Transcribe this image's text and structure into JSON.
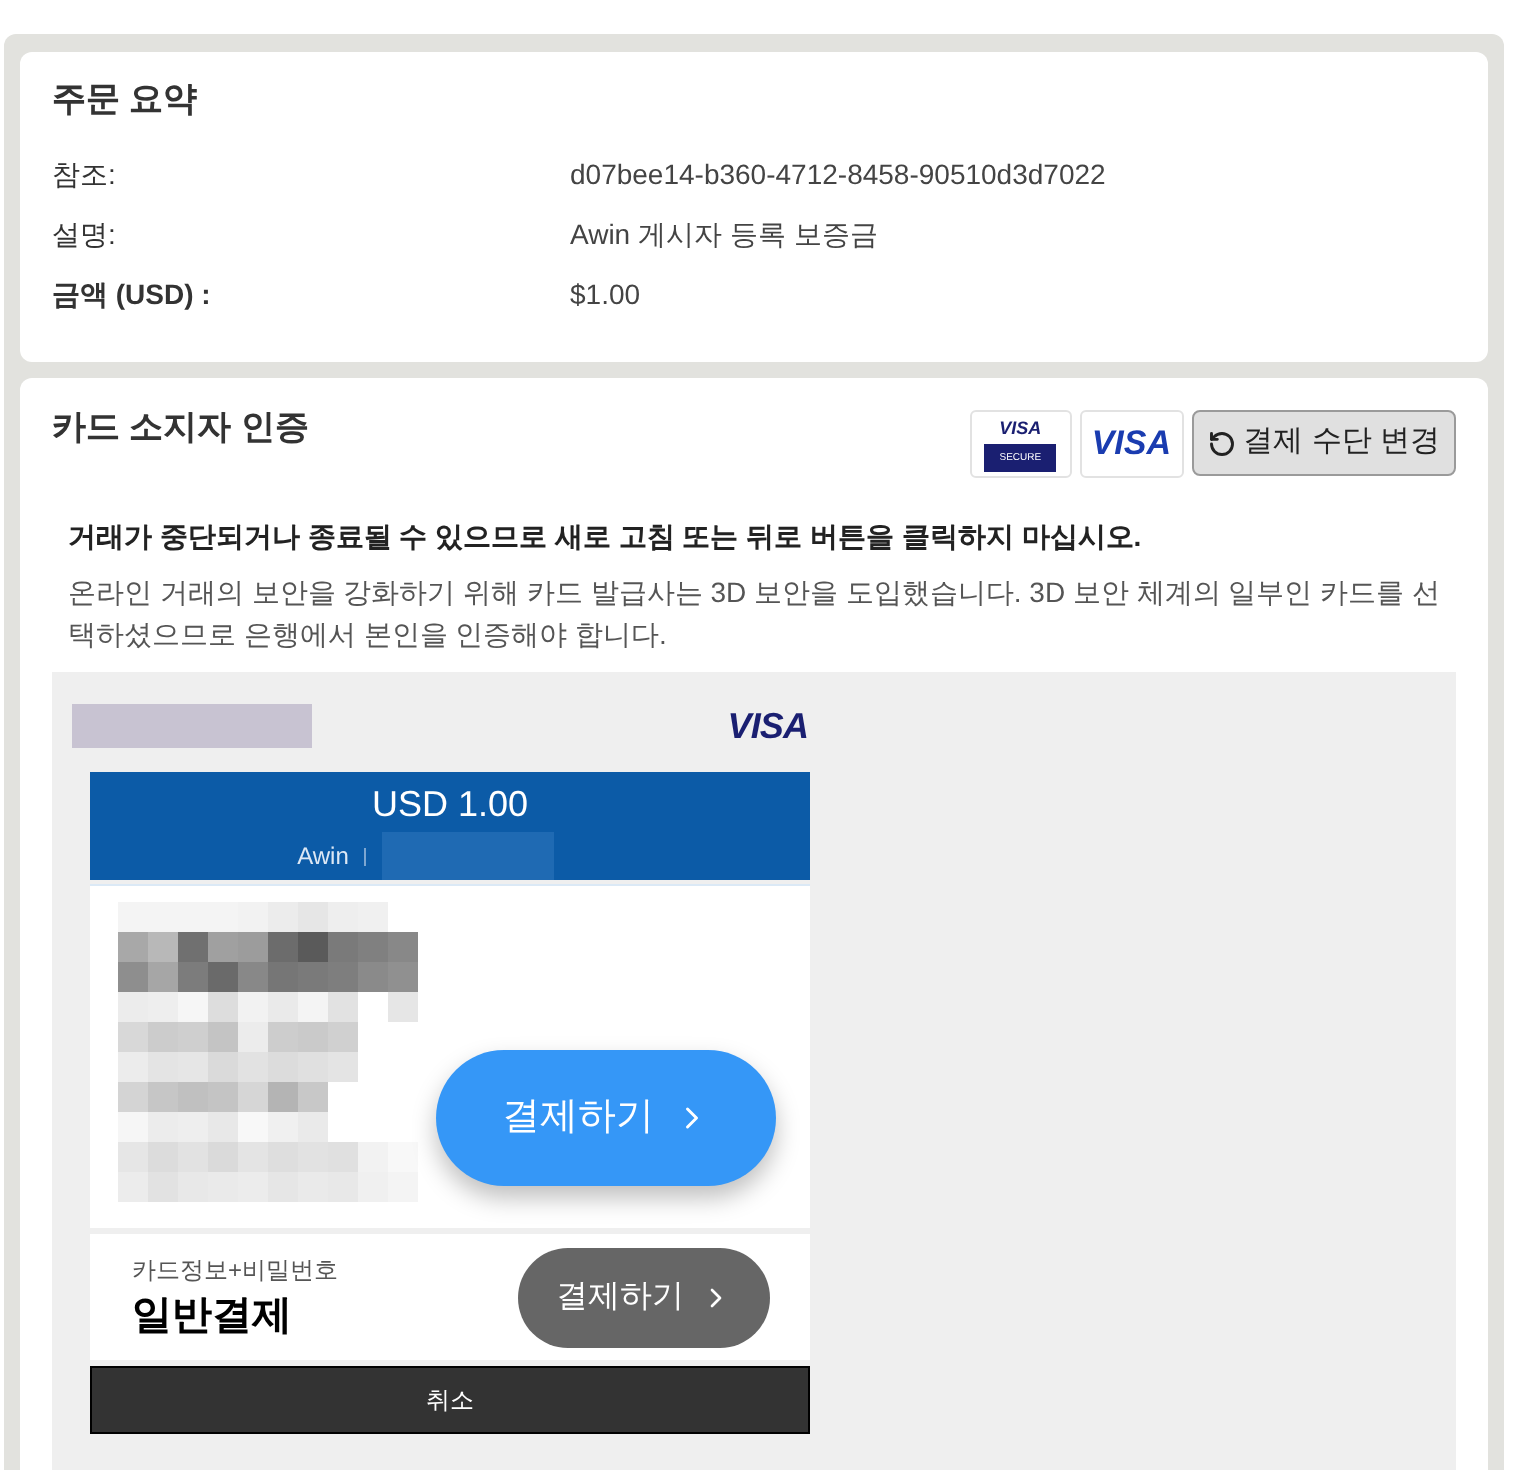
{
  "order_summary": {
    "title": "주문 요약",
    "rows": [
      {
        "label": "참조:",
        "value": "d07bee14-b360-4712-8458-90510d3d7022",
        "bold": false
      },
      {
        "label": "설명:",
        "value": "Awin 게시자 등록 보증금",
        "bold": false
      },
      {
        "label": "금액 (USD) :",
        "value": "$1.00",
        "bold": true
      }
    ]
  },
  "cardholder_auth": {
    "title": "카드 소지자 인증",
    "visa_secure_logo": {
      "brand": "VISA",
      "caption": "SECURE"
    },
    "visa_logo": "VISA",
    "change_button": "결제 수단 변경",
    "warning": "거래가 중단되거나 종료될 수 있으므로 새로 고침 또는 뒤로 버튼을 클릭하지 마십시오.",
    "description": "온라인 거래의 보안을 강화하기 위해 카드 발급사는 3D 보안을 도입했습니다. 3D 보안 체계의 일부인 카드를 선택하셨으므로 은행에서 본인을 인증해야 합니다.",
    "auth_frame": {
      "brand": "VISA",
      "amount": "USD 1.00",
      "merchant": "Awin",
      "quick_pay_button": "결제하기",
      "general_payment": {
        "caption": "카드정보+비밀번호",
        "title": "일반결제",
        "button": "결제하기"
      },
      "cancel_button": "취소"
    }
  }
}
